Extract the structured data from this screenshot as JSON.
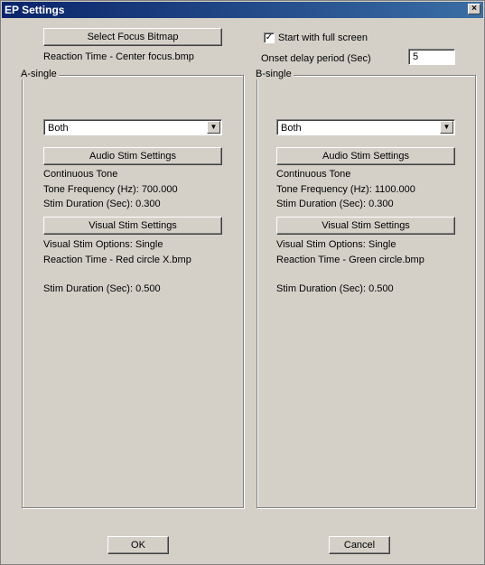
{
  "window": {
    "title": "EP Settings",
    "close_glyph": "×"
  },
  "top": {
    "select_focus_label": "Select Focus Bitmap",
    "focus_file": "Reaction Time - Center focus.bmp",
    "fullscreen_label": "Start with full screen",
    "fullscreen_checked": "✓",
    "onset_label": "Onset delay period (Sec)",
    "onset_value": "5"
  },
  "panels": [
    {
      "title": "A-single",
      "mode": "Both",
      "audio_button": "Audio Stim Settings",
      "tone_type": "Continuous Tone",
      "tone_freq": "Tone Frequency (Hz): 700.000",
      "audio_duration": "Stim Duration (Sec): 0.300",
      "visual_button": "Visual Stim Settings",
      "visual_options": "Visual Stim Options: Single",
      "visual_file": "Reaction Time - Red circle X.bmp",
      "visual_duration": "Stim Duration (Sec): 0.500"
    },
    {
      "title": "B-single",
      "mode": "Both",
      "audio_button": "Audio Stim Settings",
      "tone_type": "Continuous Tone",
      "tone_freq": "Tone Frequency (Hz): 1100.000",
      "audio_duration": "Stim Duration (Sec): 0.300",
      "visual_button": "Visual Stim Settings",
      "visual_options": "Visual Stim Options: Single",
      "visual_file": "Reaction Time - Green circle.bmp",
      "visual_duration": "Stim Duration (Sec): 0.500"
    }
  ],
  "footer": {
    "ok_label": "OK",
    "cancel_label": "Cancel"
  },
  "icons": {
    "dropdown_arrow": "▼"
  }
}
